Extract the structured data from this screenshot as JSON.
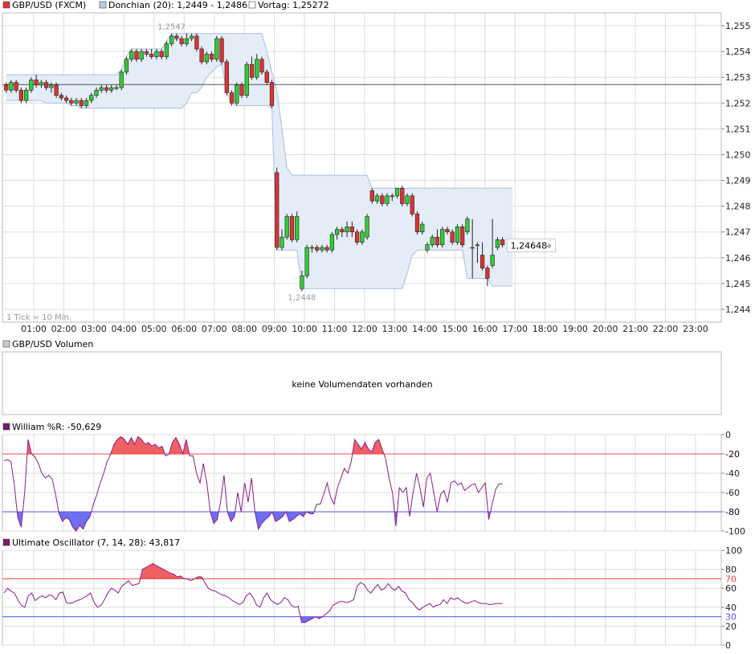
{
  "legend": {
    "main_symbol": "GBP/USD (FXCM)",
    "donchian": "Donchian (20): 1,2449 - 1,2486",
    "vortag": "Vortag: 1,25272",
    "volume_title": "GBP/USD Volumen",
    "volume_empty": "keine Volumendaten vorhanden",
    "williams": "William %R: -50,629",
    "ultimate": "Ultimate Oscillator (7, 14, 28): 43,817",
    "tick_note": "1 Tick = 10 Min."
  },
  "colors": {
    "up": "#33cc33",
    "down": "#dd3333",
    "band_fill": "#e4ecf8",
    "band_line": "#a8bfe0",
    "indicator_line": "#8b1a8b",
    "overbought": "#ee4444",
    "oversold": "#5555ee",
    "grid": "#dddddd"
  },
  "chart_data": [
    {
      "type": "candlestick",
      "ylim": [
        1.2435,
        1.2555
      ],
      "yticks": [
        1.244,
        1.245,
        1.246,
        1.247,
        1.248,
        1.249,
        1.25,
        1.251,
        1.252,
        1.253,
        1.254,
        1.255
      ],
      "ytick_labels": [
        "1,244",
        "1,245",
        "1,246",
        "1,247",
        "1,248",
        "1,249",
        "1,250",
        "1,251",
        "1,252",
        "1,253",
        "1,254",
        "1,255"
      ],
      "xticks": [
        "01:00",
        "02:00",
        "03:00",
        "04:00",
        "05:00",
        "06:00",
        "07:00",
        "08:00",
        "09:00",
        "10:00",
        "11:00",
        "12:00",
        "13:00",
        "14:00",
        "15:00",
        "16:00",
        "17:00",
        "18:00",
        "19:00",
        "20:00",
        "21:00",
        "22:00",
        "23:00"
      ],
      "previous_close": 1.25272,
      "last_price": 1.24648,
      "last_price_label": "1,24648",
      "high_label": "1,2547",
      "high_value": 1.2547,
      "low_label": "1,2448",
      "low_value": 1.2448,
      "candles": [
        [
          1.2527,
          1.2525,
          1.2528,
          1.2524
        ],
        [
          1.2525,
          1.2528,
          1.2529,
          1.2524
        ],
        [
          1.2528,
          1.2525,
          1.2529,
          1.2524
        ],
        [
          1.2525,
          1.2521,
          1.2526,
          1.252
        ],
        [
          1.2521,
          1.2525,
          1.2526,
          1.252
        ],
        [
          1.2525,
          1.2529,
          1.253,
          1.2524
        ],
        [
          1.2529,
          1.2527,
          1.2531,
          1.2526
        ],
        [
          1.2527,
          1.2528,
          1.2529,
          1.2526
        ],
        [
          1.2528,
          1.2526,
          1.2529,
          1.2525
        ],
        [
          1.2526,
          1.2527,
          1.2528,
          1.2524
        ],
        [
          1.2527,
          1.2523,
          1.2528,
          1.2522
        ],
        [
          1.2523,
          1.2522,
          1.2524,
          1.2521
        ],
        [
          1.2522,
          1.2521,
          1.2523,
          1.252
        ],
        [
          1.2521,
          1.252,
          1.2522,
          1.2519
        ],
        [
          1.252,
          1.2521,
          1.2522,
          1.2519
        ],
        [
          1.2521,
          1.2519,
          1.2522,
          1.2518
        ],
        [
          1.2519,
          1.2521,
          1.2522,
          1.2518
        ],
        [
          1.2521,
          1.2523,
          1.2524,
          1.252
        ],
        [
          1.2523,
          1.2525,
          1.2526,
          1.2522
        ],
        [
          1.2525,
          1.2526,
          1.2527,
          1.2524
        ],
        [
          1.2526,
          1.2525,
          1.2527,
          1.2524
        ],
        [
          1.2525,
          1.2526,
          1.2527,
          1.2524
        ],
        [
          1.2526,
          1.2526,
          1.2527,
          1.2525
        ],
        [
          1.2526,
          1.2532,
          1.2533,
          1.2525
        ],
        [
          1.2532,
          1.2537,
          1.2538,
          1.2531
        ],
        [
          1.2537,
          1.254,
          1.2541,
          1.2536
        ],
        [
          1.254,
          1.2537,
          1.2541,
          1.2536
        ],
        [
          1.2537,
          1.254,
          1.2541,
          1.2536
        ],
        [
          1.254,
          1.2539,
          1.2541,
          1.2538
        ],
        [
          1.2539,
          1.2538,
          1.2541,
          1.2537
        ],
        [
          1.2538,
          1.254,
          1.2541,
          1.2537
        ],
        [
          1.254,
          1.2538,
          1.2541,
          1.2537
        ],
        [
          1.2538,
          1.2543,
          1.2544,
          1.2537
        ],
        [
          1.2543,
          1.2546,
          1.2547,
          1.2542
        ],
        [
          1.2546,
          1.2545,
          1.2547,
          1.2544
        ],
        [
          1.2545,
          1.2543,
          1.2546,
          1.2542
        ],
        [
          1.2543,
          1.2545,
          1.2547,
          1.2542
        ],
        [
          1.2545,
          1.2546,
          1.2547,
          1.2544
        ],
        [
          1.2546,
          1.2541,
          1.2547,
          1.254
        ],
        [
          1.2541,
          1.2536,
          1.2542,
          1.2535
        ],
        [
          1.2536,
          1.2539,
          1.254,
          1.2535
        ],
        [
          1.2539,
          1.2537,
          1.254,
          1.2536
        ],
        [
          1.2537,
          1.2545,
          1.2546,
          1.2536
        ],
        [
          1.2545,
          1.2536,
          1.2546,
          1.2535
        ],
        [
          1.2536,
          1.2524,
          1.2537,
          1.2523
        ],
        [
          1.2524,
          1.252,
          1.2525,
          1.2519
        ],
        [
          1.252,
          1.2527,
          1.2528,
          1.2519
        ],
        [
          1.2527,
          1.2523,
          1.2528,
          1.2522
        ],
        [
          1.2523,
          1.2535,
          1.2536,
          1.2522
        ],
        [
          1.2535,
          1.253,
          1.2538,
          1.2529
        ],
        [
          1.253,
          1.2537,
          1.2539,
          1.2529
        ],
        [
          1.2537,
          1.2532,
          1.2538,
          1.2531
        ],
        [
          1.2532,
          1.2528,
          1.2533,
          1.2527
        ],
        [
          1.2528,
          1.2519,
          1.2529,
          1.2518
        ],
        [
          1.2493,
          1.2464,
          1.2495,
          1.2463
        ],
        [
          1.2464,
          1.2468,
          1.2471,
          1.2463
        ],
        [
          1.2468,
          1.2476,
          1.2477,
          1.2467
        ],
        [
          1.2476,
          1.2467,
          1.2477,
          1.2466
        ],
        [
          1.2467,
          1.2476,
          1.2478,
          1.2466
        ],
        [
          1.2448,
          1.2453,
          1.2455,
          1.2447
        ],
        [
          1.2453,
          1.2464,
          1.2465,
          1.2452
        ],
        [
          1.2464,
          1.2464,
          1.2465,
          1.2462
        ],
        [
          1.2464,
          1.2463,
          1.2465,
          1.2462
        ],
        [
          1.2463,
          1.2464,
          1.2465,
          1.2462
        ],
        [
          1.2464,
          1.2463,
          1.2465,
          1.2462
        ],
        [
          1.2463,
          1.2469,
          1.247,
          1.2462
        ],
        [
          1.2469,
          1.2471,
          1.2472,
          1.2467
        ],
        [
          1.2471,
          1.247,
          1.2472,
          1.2468
        ],
        [
          1.247,
          1.2472,
          1.2474,
          1.2468
        ],
        [
          1.2472,
          1.247,
          1.2474,
          1.2468
        ],
        [
          1.247,
          1.2466,
          1.2471,
          1.2465
        ],
        [
          1.2466,
          1.247,
          1.2471,
          1.2465
        ],
        [
          1.2468,
          1.2476,
          1.2477,
          1.2467
        ],
        [
          1.2486,
          1.2482,
          1.2487,
          1.2481
        ],
        [
          1.2482,
          1.2484,
          1.2485,
          1.2481
        ],
        [
          1.2484,
          1.2481,
          1.2485,
          1.248
        ],
        [
          1.2481,
          1.2484,
          1.2485,
          1.248
        ],
        [
          1.2484,
          1.2484,
          1.2485,
          1.2482
        ],
        [
          1.2484,
          1.2487,
          1.2487,
          1.2483
        ],
        [
          1.2487,
          1.2481,
          1.2488,
          1.248
        ],
        [
          1.2481,
          1.2484,
          1.2485,
          1.248
        ],
        [
          1.2484,
          1.2477,
          1.2485,
          1.2476
        ],
        [
          1.2477,
          1.247,
          1.2478,
          1.2469
        ],
        [
          1.247,
          1.2473,
          1.2474,
          1.2469
        ],
        [
          1.2463,
          1.2465,
          1.2466,
          1.2462
        ],
        [
          1.2465,
          1.2468,
          1.2469,
          1.2464
        ],
        [
          1.2468,
          1.2465,
          1.2471,
          1.2464
        ],
        [
          1.2465,
          1.2471,
          1.2472,
          1.2464
        ],
        [
          1.2471,
          1.247,
          1.2472,
          1.2469
        ],
        [
          1.247,
          1.2466,
          1.2471,
          1.2465
        ],
        [
          1.2466,
          1.2472,
          1.2473,
          1.2465
        ],
        [
          1.2472,
          1.2465,
          1.2473,
          1.2464
        ],
        [
          1.247,
          1.2475,
          1.2476,
          1.2469
        ],
        [
          1.2464,
          1.2464,
          1.2475,
          1.2452
        ],
        [
          1.2465,
          1.2465,
          1.2466,
          1.2458
        ],
        [
          1.2461,
          1.2456,
          1.2466,
          1.2455
        ],
        [
          1.2456,
          1.2452,
          1.2457,
          1.2449
        ],
        [
          1.2457,
          1.2461,
          1.2475,
          1.2456
        ],
        [
          1.2464,
          1.2467,
          1.2468,
          1.2463
        ],
        [
          1.2467,
          1.2465,
          1.2468,
          1.2464
        ]
      ],
      "donchian_upper": [
        1.2531,
        1.2531,
        1.2531,
        1.2531,
        1.2531,
        1.2531,
        1.2531,
        1.2531,
        1.2531,
        1.2531,
        1.2531,
        1.2531,
        1.2531,
        1.2531,
        1.2531,
        1.2531,
        1.2531,
        1.2531,
        1.2531,
        1.2531,
        1.2531,
        1.2531,
        1.2531,
        1.2533,
        1.2538,
        1.2541,
        1.2541,
        1.2541,
        1.2541,
        1.2541,
        1.2541,
        1.2541,
        1.2544,
        1.2547,
        1.2547,
        1.2547,
        1.2547,
        1.2547,
        1.2547,
        1.2547,
        1.2547,
        1.2547,
        1.2547,
        1.2547,
        1.2547,
        1.2547,
        1.2547,
        1.2547,
        1.2547,
        1.2547,
        1.2547,
        1.2547,
        1.254,
        1.2532,
        1.2525,
        1.251,
        1.2495,
        1.2492,
        1.2492,
        1.2492,
        1.2492,
        1.2492,
        1.2492,
        1.2492,
        1.2492,
        1.2492,
        1.2492,
        1.2492,
        1.2492,
        1.2492,
        1.2492,
        1.2492,
        1.2492,
        1.2487,
        1.2487,
        1.2487,
        1.2487,
        1.2487,
        1.2487,
        1.2487,
        1.2487,
        1.2487,
        1.2487,
        1.2487,
        1.2487,
        1.2487,
        1.2487,
        1.2487,
        1.2487,
        1.2487,
        1.2487,
        1.2487,
        1.2487,
        1.2487,
        1.2487,
        1.2487,
        1.2487,
        1.2487,
        1.2487,
        1.2487,
        1.2487,
        1.2487
      ],
      "donchian_lower": [
        1.2521,
        1.2521,
        1.2521,
        1.2521,
        1.2521,
        1.2521,
        1.2521,
        1.2521,
        1.252,
        1.252,
        1.252,
        1.252,
        1.252,
        1.2519,
        1.2519,
        1.2518,
        1.2518,
        1.2518,
        1.2518,
        1.2518,
        1.2518,
        1.2518,
        1.2518,
        1.2518,
        1.2518,
        1.2518,
        1.2518,
        1.2518,
        1.2518,
        1.2518,
        1.2518,
        1.2518,
        1.2518,
        1.2518,
        1.2518,
        1.2518,
        1.252,
        1.2524,
        1.2524,
        1.2526,
        1.253,
        1.2532,
        1.2534,
        1.2535,
        1.2524,
        1.252,
        1.2519,
        1.2519,
        1.2519,
        1.2519,
        1.2519,
        1.2519,
        1.2519,
        1.2518,
        1.2463,
        1.2463,
        1.2463,
        1.2463,
        1.2463,
        1.2448,
        1.2448,
        1.2448,
        1.2448,
        1.2448,
        1.2448,
        1.2448,
        1.2448,
        1.2448,
        1.2448,
        1.2448,
        1.2448,
        1.2448,
        1.2448,
        1.2448,
        1.2448,
        1.2448,
        1.2448,
        1.2448,
        1.2448,
        1.2448,
        1.2454,
        1.2461,
        1.2463,
        1.2463,
        1.2463,
        1.2463,
        1.2463,
        1.2463,
        1.2463,
        1.2463,
        1.2463,
        1.2463,
        1.2452,
        1.2452,
        1.2452,
        1.2452,
        1.2452,
        1.2449,
        1.2449,
        1.2449,
        1.2449,
        1.2449
      ]
    },
    {
      "type": "line",
      "name": "William %R",
      "ylim": [
        -100,
        0
      ],
      "yticks": [
        0,
        -20,
        -40,
        -60,
        -80,
        -100
      ],
      "ytick_labels": [
        "0",
        "-20",
        "-40",
        "-60",
        "-80",
        "-100"
      ],
      "levels": [
        -20,
        -80
      ],
      "level_labels": [
        "-20",
        "-80"
      ],
      "values": [
        -27,
        -26,
        -28,
        -52,
        -86,
        -96,
        -60,
        -5,
        -20,
        -23,
        -30,
        -40,
        -45,
        -42,
        -46,
        -62,
        -82,
        -90,
        -86,
        -88,
        -96,
        -100,
        -94,
        -98,
        -90,
        -85,
        -72,
        -62,
        -50,
        -40,
        -28,
        -20,
        -10,
        -5,
        -2,
        -5,
        -10,
        -3,
        -10,
        -2,
        -5,
        -10,
        -8,
        -12,
        -10,
        -14,
        -12,
        -22,
        -20,
        -8,
        -3,
        -10,
        -20,
        -5,
        -22,
        -22,
        -40,
        -50,
        -30,
        -50,
        -80,
        -92,
        -88,
        -70,
        -42,
        -80,
        -90,
        -85,
        -60,
        -80,
        -50,
        -70,
        -45,
        -80,
        -98,
        -92,
        -88,
        -85,
        -80,
        -90,
        -88,
        -85,
        -80,
        -90,
        -88,
        -85,
        -82,
        -85,
        -80,
        -82,
        -82,
        -72,
        -72,
        -62,
        -50,
        -65,
        -72,
        -55,
        -45,
        -35,
        -40,
        -28,
        -5,
        -10,
        -15,
        -8,
        -15,
        -18,
        -8,
        -5,
        -15,
        -25,
        -45,
        -60,
        -95,
        -55,
        -60,
        -55,
        -85,
        -60,
        -40,
        -55,
        -75,
        -45,
        -40,
        -60,
        -80,
        -62,
        -58,
        -70,
        -50,
        -48,
        -52,
        -50,
        -58,
        -55,
        -52,
        -51,
        -60,
        -55,
        -50,
        -88,
        -72,
        -57,
        -51,
        -51
      ]
    },
    {
      "type": "line",
      "name": "Ultimate Oscillator",
      "ylim": [
        0,
        100
      ],
      "yticks": [
        100,
        80,
        60,
        40,
        20,
        0
      ],
      "ytick_labels": [
        "100",
        "80",
        "60",
        "40",
        "20",
        "0"
      ],
      "levels": [
        70,
        30
      ],
      "level_labels": [
        "70",
        "30"
      ],
      "values": [
        55,
        60,
        57,
        55,
        48,
        42,
        40,
        52,
        55,
        47,
        50,
        52,
        50,
        53,
        52,
        48,
        55,
        56,
        45,
        44,
        45,
        47,
        48,
        50,
        52,
        55,
        45,
        40,
        42,
        48,
        55,
        60,
        58,
        55,
        62,
        65,
        68,
        63,
        64,
        65,
        80,
        82,
        84,
        86,
        84,
        82,
        80,
        78,
        76,
        75,
        72,
        73,
        70,
        70,
        68,
        70,
        72,
        72,
        66,
        60,
        58,
        57,
        55,
        53,
        52,
        50,
        47,
        45,
        43,
        45,
        52,
        55,
        50,
        42,
        40,
        50,
        55,
        48,
        45,
        43,
        45,
        50,
        48,
        42,
        40,
        41,
        24,
        24,
        26,
        28,
        30,
        28,
        30,
        33,
        36,
        42,
        44,
        46,
        46,
        45,
        46,
        48,
        62,
        66,
        64,
        58,
        55,
        60,
        64,
        58,
        60,
        65,
        60,
        58,
        62,
        57,
        55,
        48,
        45,
        40,
        37,
        40,
        42,
        44,
        40,
        42,
        43,
        48,
        44,
        50,
        48,
        50,
        47,
        45,
        44,
        46,
        47,
        45,
        44,
        44,
        43,
        43,
        44,
        44,
        44
      ]
    }
  ]
}
